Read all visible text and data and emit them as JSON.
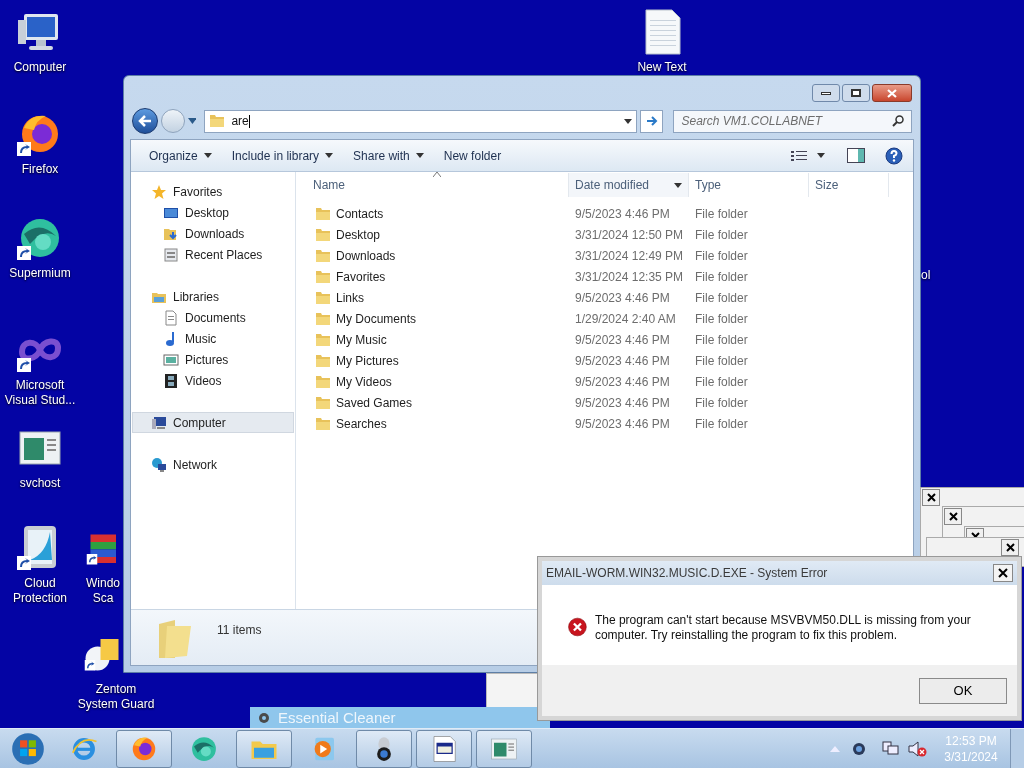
{
  "desktop_icons": [
    {
      "kind": "computer",
      "label": "Computer",
      "shortcut": false
    },
    {
      "kind": "firefox",
      "label": "Firefox",
      "shortcut": true
    },
    {
      "kind": "supermium",
      "label": "Supermium",
      "shortcut": true
    },
    {
      "kind": "infinity",
      "label": "Microsoft Visual Stud...",
      "shortcut": true
    },
    {
      "kind": "window",
      "label": "svchost",
      "shortcut": false
    },
    {
      "kind": "shield",
      "label": "Cloud Protection",
      "shortcut": true
    },
    {
      "kind": "books",
      "label": "Windo Sca",
      "shortcut": true
    },
    {
      "kind": "guard",
      "label": "Zentom System Guard",
      "shortcut": true
    },
    {
      "kind": "textfile",
      "label": "New Text",
      "shortcut": false
    }
  ],
  "partial_label": "ol",
  "explorer": {
    "address": "are",
    "search_placeholder": "Search VM1.COLLABNET",
    "toolbar": [
      {
        "label": "Organize",
        "menu": true
      },
      {
        "label": "Include in library",
        "menu": true
      },
      {
        "label": "Share with",
        "menu": true
      },
      {
        "label": "New folder",
        "menu": false
      }
    ],
    "nav": [
      {
        "label": "Favorites",
        "kind": "star",
        "selected": false,
        "children": [
          {
            "label": "Desktop",
            "kind": "desktop",
            "selected": false
          },
          {
            "label": "Downloads",
            "kind": "downloads",
            "selected": false
          },
          {
            "label": "Recent Places",
            "kind": "recent",
            "selected": false
          }
        ]
      },
      {
        "label": "Libraries",
        "kind": "library",
        "selected": false,
        "children": [
          {
            "label": "Documents",
            "kind": "document",
            "selected": false
          },
          {
            "label": "Music",
            "kind": "music",
            "selected": false
          },
          {
            "label": "Pictures",
            "kind": "picture",
            "selected": false
          },
          {
            "label": "Videos",
            "kind": "video",
            "selected": false
          }
        ]
      },
      {
        "label": "Computer",
        "kind": "computer",
        "selected": true
      },
      {
        "label": "Network",
        "kind": "network",
        "selected": false
      }
    ],
    "columns": [
      "Name",
      "Date modified",
      "Type",
      "Size"
    ],
    "rows": [
      {
        "name": "Contacts",
        "date": "9/5/2023 4:46 PM",
        "type": "File folder"
      },
      {
        "name": "Desktop",
        "date": "3/31/2024 12:50 PM",
        "type": "File folder"
      },
      {
        "name": "Downloads",
        "date": "3/31/2024 12:49 PM",
        "type": "File folder"
      },
      {
        "name": "Favorites",
        "date": "3/31/2024 12:35 PM",
        "type": "File folder"
      },
      {
        "name": "Links",
        "date": "9/5/2023 4:46 PM",
        "type": "File folder"
      },
      {
        "name": "My Documents",
        "date": "1/29/2024 2:40 AM",
        "type": "File folder"
      },
      {
        "name": "My Music",
        "date": "9/5/2023 4:46 PM",
        "type": "File folder"
      },
      {
        "name": "My Pictures",
        "date": "9/5/2023 4:46 PM",
        "type": "File folder"
      },
      {
        "name": "My Videos",
        "date": "9/5/2023 4:46 PM",
        "type": "File folder"
      },
      {
        "name": "Saved Games",
        "date": "9/5/2023 4:46 PM",
        "type": "File folder"
      },
      {
        "name": "Searches",
        "date": "9/5/2023 4:46 PM",
        "type": "File folder"
      }
    ],
    "status": "11 items"
  },
  "background_window": {
    "title": "Essential Cleaner"
  },
  "error_dialog": {
    "title": "EMAIL-WORM.WIN32.MUSIC.D.EXE - System Error",
    "message": "The program can't start because MSVBVM50.DLL is missing from your computer. Try reinstalling the program to fix this problem.",
    "button": "OK"
  },
  "taskbar": {
    "items": [
      {
        "kind": "start",
        "open": false
      },
      {
        "kind": "ie",
        "open": false
      },
      {
        "kind": "firefox",
        "open": true
      },
      {
        "kind": "supermium",
        "open": false
      },
      {
        "kind": "folder",
        "open": true
      },
      {
        "kind": "media",
        "open": false
      },
      {
        "kind": "webcam",
        "open": true
      },
      {
        "kind": "appdoc",
        "open": true
      },
      {
        "kind": "window",
        "open": true
      }
    ],
    "time": "12:53 PM",
    "date": "3/31/2024"
  }
}
